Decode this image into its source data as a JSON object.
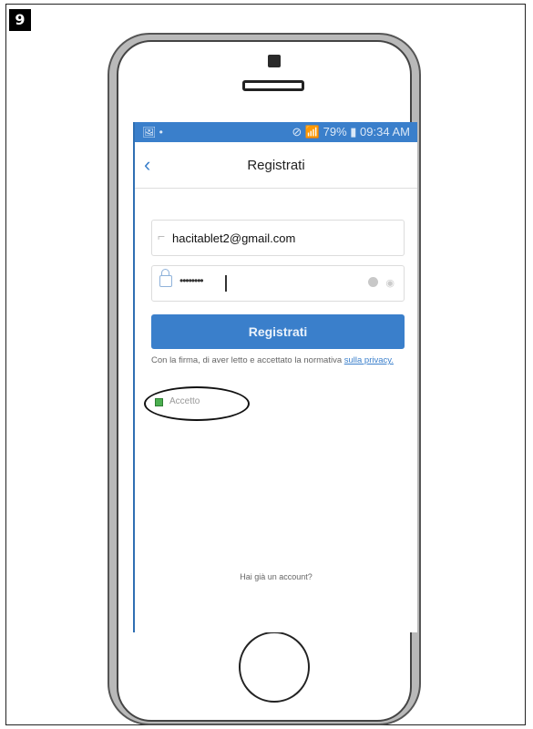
{
  "step_number": "9",
  "status_bar": {
    "left_icons": "🖼 •",
    "right_text": "⊘ 📶 79% ▮ 09:34 AM"
  },
  "header": {
    "title": "Registrati"
  },
  "form": {
    "email_value": "hacitablet2@gmail.com",
    "password_value": "••••••••",
    "register_label": "Registrati"
  },
  "terms": {
    "text": "Con la firma, di aver letto e accettato la normativa ",
    "link": "sulla privacy."
  },
  "accept": {
    "label": "Accetto",
    "checked": true
  },
  "footer": {
    "login_link": "Hai già un account?"
  },
  "colors": {
    "accent": "#3a7fcb",
    "checkbox": "#4caf50"
  },
  "icons": [
    "back-icon",
    "person-icon",
    "lock-icon",
    "clear-icon",
    "eye-icon",
    "camera-icon"
  ]
}
